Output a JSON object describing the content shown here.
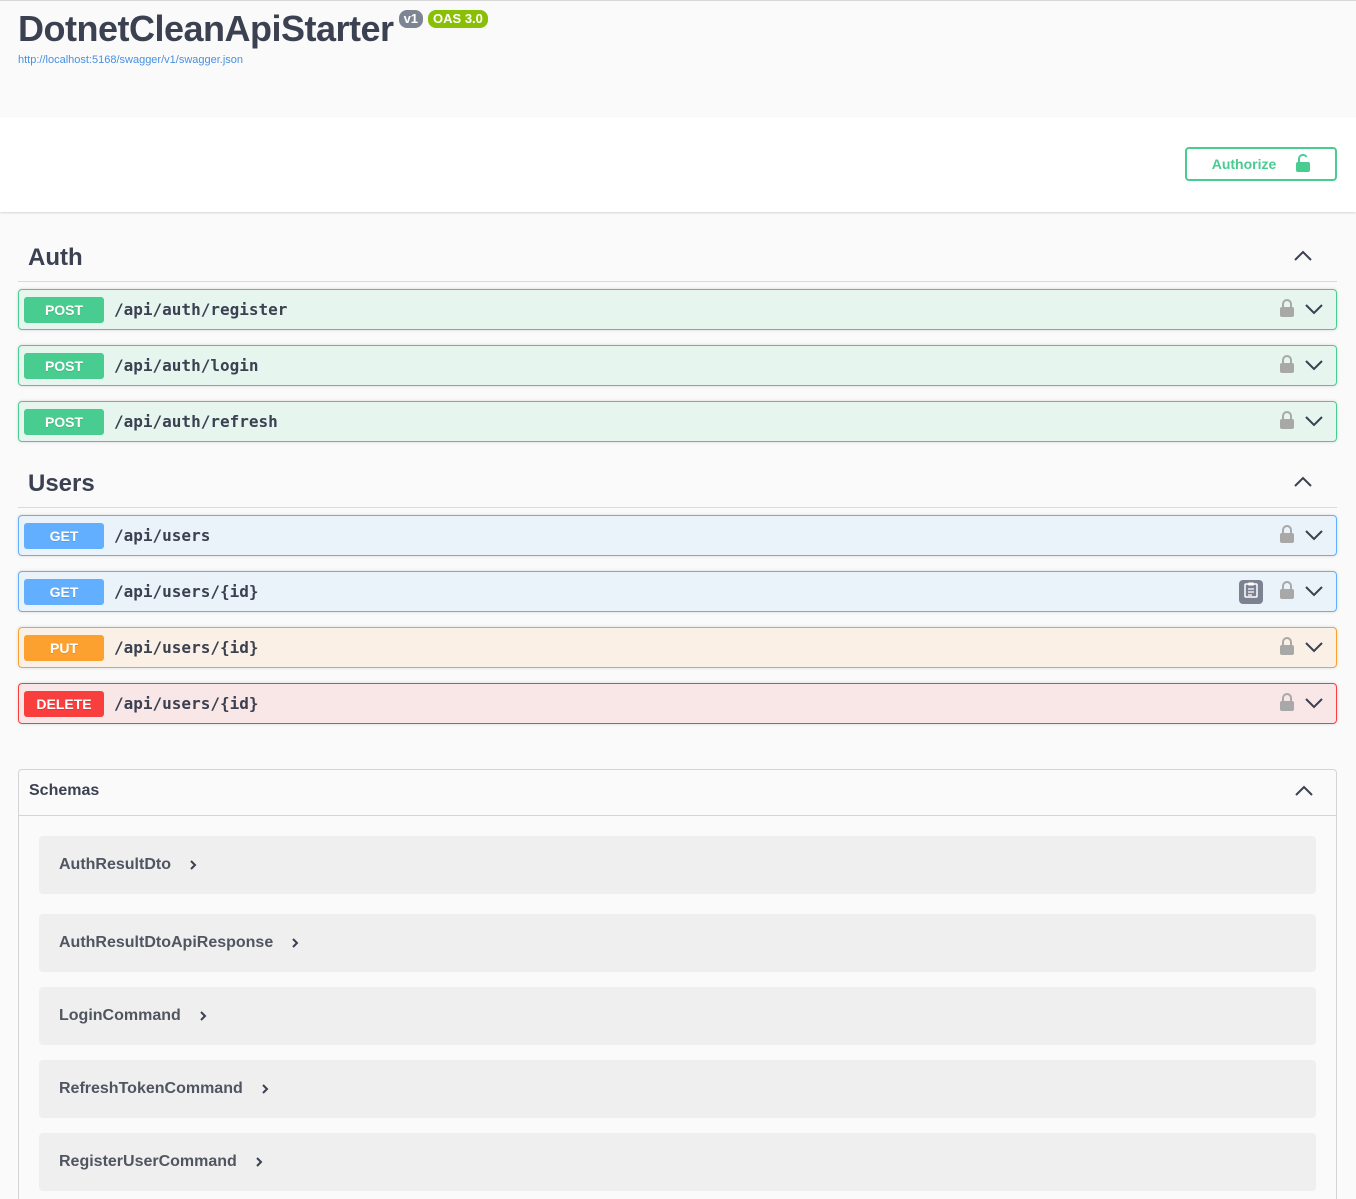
{
  "info": {
    "title": "DotnetCleanApiStarter",
    "version": "v1",
    "oas": "OAS 3.0",
    "spec_url": "http://localhost:5168/swagger/v1/swagger.json"
  },
  "scheme": {
    "authorize_label": "Authorize"
  },
  "tags": [
    {
      "name": "Auth",
      "operations": [
        {
          "method": "POST",
          "path": "/api/auth/register"
        },
        {
          "method": "POST",
          "path": "/api/auth/login"
        },
        {
          "method": "POST",
          "path": "/api/auth/refresh"
        }
      ]
    },
    {
      "name": "Users",
      "operations": [
        {
          "method": "GET",
          "path": "/api/users"
        },
        {
          "method": "GET",
          "path": "/api/users/{id}"
        },
        {
          "method": "PUT",
          "path": "/api/users/{id}"
        },
        {
          "method": "DELETE",
          "path": "/api/users/{id}"
        }
      ]
    }
  ],
  "schemas": {
    "title": "Schemas",
    "models": [
      "AuthResultDto",
      "AuthResultDtoApiResponse",
      "LoginCommand",
      "RefreshTokenCommand",
      "RegisterUserCommand"
    ]
  },
  "colors": {
    "post": "#49cc90",
    "get": "#61affe",
    "put": "#fca130",
    "delete": "#f93e3e"
  }
}
